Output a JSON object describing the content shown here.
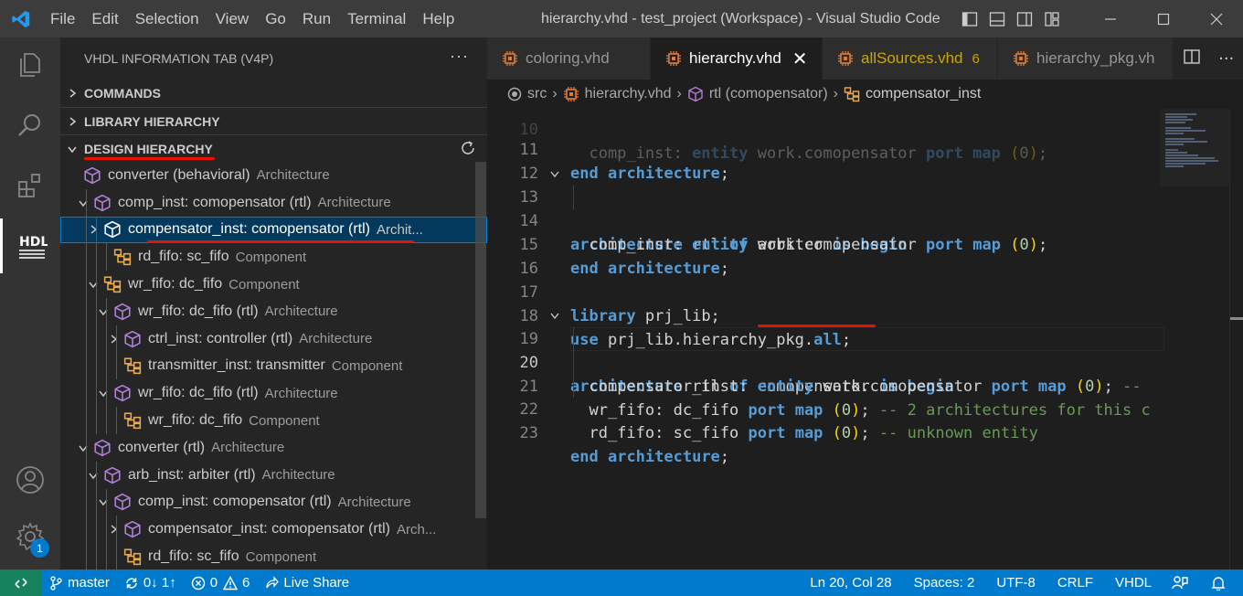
{
  "window": {
    "title": "hierarchy.vhd - test_project (Workspace) - Visual Studio Code",
    "menu": [
      "File",
      "Edit",
      "Selection",
      "View",
      "Go",
      "Run",
      "Terminal",
      "Help"
    ]
  },
  "sidebar": {
    "header": "VHDL INFORMATION TAB (V4P)",
    "more": "···",
    "sections": {
      "commands": "COMMANDS",
      "library": "LIBRARY HIERARCHY",
      "design": "DESIGN HIERARCHY"
    },
    "tree": [
      {
        "label": "converter (behavioral)",
        "desc": "Architecture"
      },
      {
        "label": "comp_inst: comopensator (rtl)",
        "desc": "Architecture"
      },
      {
        "label": "compensator_inst: comopensator (rtl)",
        "desc": "Archit..."
      },
      {
        "label": "rd_fifo: sc_fifo",
        "desc": "Component"
      },
      {
        "label": "wr_fifo: dc_fifo",
        "desc": "Component"
      },
      {
        "label": "wr_fifo: dc_fifo (rtl)",
        "desc": "Architecture"
      },
      {
        "label": "ctrl_inst: controller (rtl)",
        "desc": "Architecture"
      },
      {
        "label": "transmitter_inst: transmitter",
        "desc": "Component"
      },
      {
        "label": "wr_fifo: dc_fifo (rtl)",
        "desc": "Architecture"
      },
      {
        "label": "wr_fifo: dc_fifo",
        "desc": "Component"
      },
      {
        "label": "converter (rtl)",
        "desc": "Architecture"
      },
      {
        "label": "arb_inst: arbiter (rtl)",
        "desc": "Architecture"
      },
      {
        "label": "comp_inst: comopensator (rtl)",
        "desc": "Architecture"
      },
      {
        "label": "compensator_inst: comopensator (rtl)",
        "desc": "Arch..."
      },
      {
        "label": "rd_fifo: sc_fifo",
        "desc": "Component"
      }
    ]
  },
  "tabs": [
    {
      "label": "coloring.vhd",
      "active": false
    },
    {
      "label": "hierarchy.vhd",
      "active": true,
      "close": "✕"
    },
    {
      "label": "allSources.vhd",
      "count": "6",
      "active": false
    },
    {
      "label": "hierarchy_pkg.vh",
      "active": false
    }
  ],
  "breadcrumb": [
    "src",
    "hierarchy.vhd",
    "rtl (comopensator)",
    "compensator_inst"
  ],
  "code": {
    "lines": [
      11,
      12,
      13,
      14,
      15,
      16,
      17,
      18,
      19,
      20,
      21,
      22,
      23
    ],
    "current_line": 20,
    "text": {
      "l11": [
        "end",
        "architecture",
        ";"
      ],
      "l13": [
        "architecture",
        "rtl",
        "of",
        "arbiter",
        "is",
        "begin"
      ],
      "l14": [
        "comp_inst:",
        "entity",
        "work.comopensator",
        "port",
        "map",
        "(",
        "0",
        ");"
      ],
      "l15": [
        "end",
        "architecture",
        ";"
      ],
      "l17": [
        "library",
        "prj_lib;"
      ],
      "l18": [
        "use",
        "prj_lib.hierarchy_pkg.",
        "all",
        ";"
      ],
      "l19": [
        "architecture",
        "rtl",
        "of",
        "comopensator",
        "is",
        "begin"
      ],
      "l20": [
        "compensator_inst:",
        "entity",
        "work.comopensator",
        "port",
        "map",
        "(",
        "0",
        ");",
        "--"
      ],
      "l21": [
        "wr_fifo: dc_fifo",
        "port",
        "map",
        "(",
        "0",
        ");",
        "-- 2 architectures for this c"
      ],
      "l22": [
        "rd_fifo: sc_fifo",
        "port",
        "map",
        "(",
        "0",
        ");",
        "-- unknown entity"
      ],
      "l23": [
        "end",
        "architecture",
        ";"
      ]
    }
  },
  "status": {
    "branch": "master",
    "sync": "0↓ 1↑",
    "errors": "0",
    "warnings": "6",
    "liveshare": "Live Share",
    "position": "Ln 20, Col 28",
    "spaces": "Spaces: 2",
    "encoding": "UTF-8",
    "eol": "CRLF",
    "language": "VHDL"
  },
  "activity": {
    "badge": "1"
  },
  "colors": {
    "accent": "#007acc",
    "underline": "#e51400",
    "component_icon": "#e8ab53",
    "arch_icon": "#b180d7"
  }
}
